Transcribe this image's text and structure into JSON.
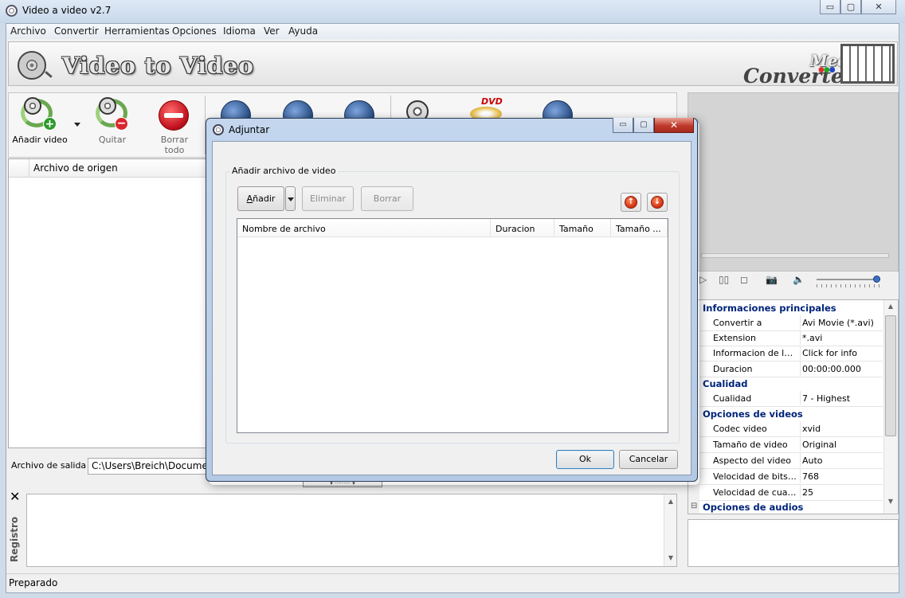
{
  "window": {
    "title": "Video a video v2.7",
    "controls": {
      "minimize": "▭",
      "restore": "▢",
      "close": "✕"
    }
  },
  "menu": [
    "Archivo",
    "Convertir",
    "Herramientas",
    "Opciones",
    "Idioma",
    "Ver",
    "Ayuda"
  ],
  "banner": {
    "title": "Video to Video",
    "brand_top": "Media",
    "brand_bottom": "Converters"
  },
  "toolbar": {
    "add_video": "Añadir video",
    "remove": "Quitar",
    "clear_all": "Borrar todo"
  },
  "file_list": {
    "column_source": "Archivo de origen"
  },
  "output": {
    "label": "Archivo de salida",
    "path": "C:\\Users\\Breich\\Documen"
  },
  "log": {
    "tab_label": "Registro",
    "close": "✕"
  },
  "status": {
    "text": "Preparado"
  },
  "properties": {
    "categories": [
      {
        "name": "Informaciones principales",
        "rows": [
          {
            "key": "Convertir a",
            "value": "Avi Movie (*.avi)"
          },
          {
            "key": "Extension",
            "value": "*.avi"
          },
          {
            "key": "Informacion de la fu...",
            "value": "Click for info"
          },
          {
            "key": "Duracion",
            "value": "00:00:00.000"
          }
        ]
      },
      {
        "name": "Cualidad",
        "rows": [
          {
            "key": "Cualidad",
            "value": "7 - Highest"
          }
        ]
      },
      {
        "name": "Opciones de videos",
        "rows": [
          {
            "key": "Codec video",
            "value": "xvid"
          },
          {
            "key": "Tamaño de video",
            "value": "Original"
          },
          {
            "key": "Aspecto del video",
            "value": "Auto"
          },
          {
            "key": "Velocidad de bits d...",
            "value": "768"
          },
          {
            "key": "Velocidad de cuadr...",
            "value": "25"
          }
        ]
      },
      {
        "name": "Opciones de audios",
        "collapsed_marker": "⊟",
        "rows": []
      }
    ]
  },
  "player": {
    "volume_fraction": 0.95
  },
  "dialog": {
    "title": "Adjuntar",
    "group_label": "Añadir archivo de video",
    "add_button": "Añadir",
    "add_button_underlined_letter": "A",
    "add_button_rest": "ñadir",
    "delete_button": "Eliminar",
    "clear_button": "Borrar",
    "columns": [
      "Nombre de archivo",
      "Duracion",
      "Tamaño",
      "Tamaño ..."
    ],
    "ok_button": "Ok",
    "cancel_button": "Cancelar",
    "controls": {
      "minimize": "▭",
      "restore": "▢",
      "close": "✕"
    }
  },
  "colors": {
    "category_text": "#00247a",
    "dialog_frame": "#b4c9e4",
    "close_button": "#c0392b"
  },
  "icons": {
    "app": "film-reel-icon",
    "add": "add-video-icon",
    "remove": "remove-video-icon",
    "clear": "stop-sign-icon",
    "move_up": "arrow-up-circle-icon",
    "move_down": "arrow-down-circle-icon"
  }
}
